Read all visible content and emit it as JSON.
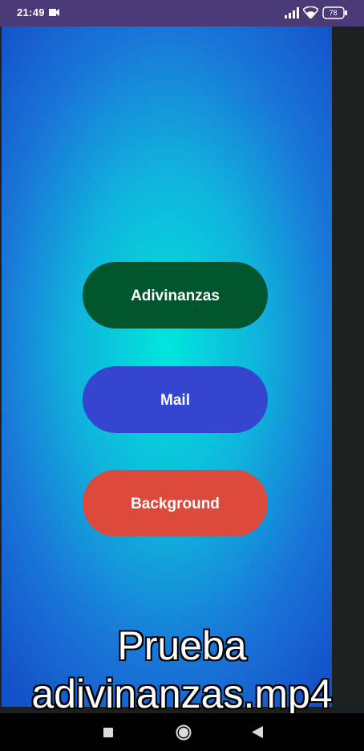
{
  "status_bar": {
    "time": "21:49",
    "battery_level": "78",
    "icons": [
      "video-icon",
      "signal-icon",
      "wifi-icon",
      "battery-icon"
    ],
    "background_color": "#4a3b78"
  },
  "app": {
    "background_center_color": "#00e6dc",
    "background_edge_color": "#1451c8",
    "buttons": [
      {
        "label": "Adivinanzas",
        "color": "#02562e"
      },
      {
        "label": "Mail",
        "color": "#3446d0"
      },
      {
        "label": "Background",
        "color": "#dc4a3b"
      }
    ]
  },
  "caption": {
    "line1": "Prueba",
    "line2": "adivinanzas.mp4"
  },
  "nav_bar": {
    "icons": [
      "recents-icon",
      "home-icon",
      "back-icon"
    ]
  }
}
